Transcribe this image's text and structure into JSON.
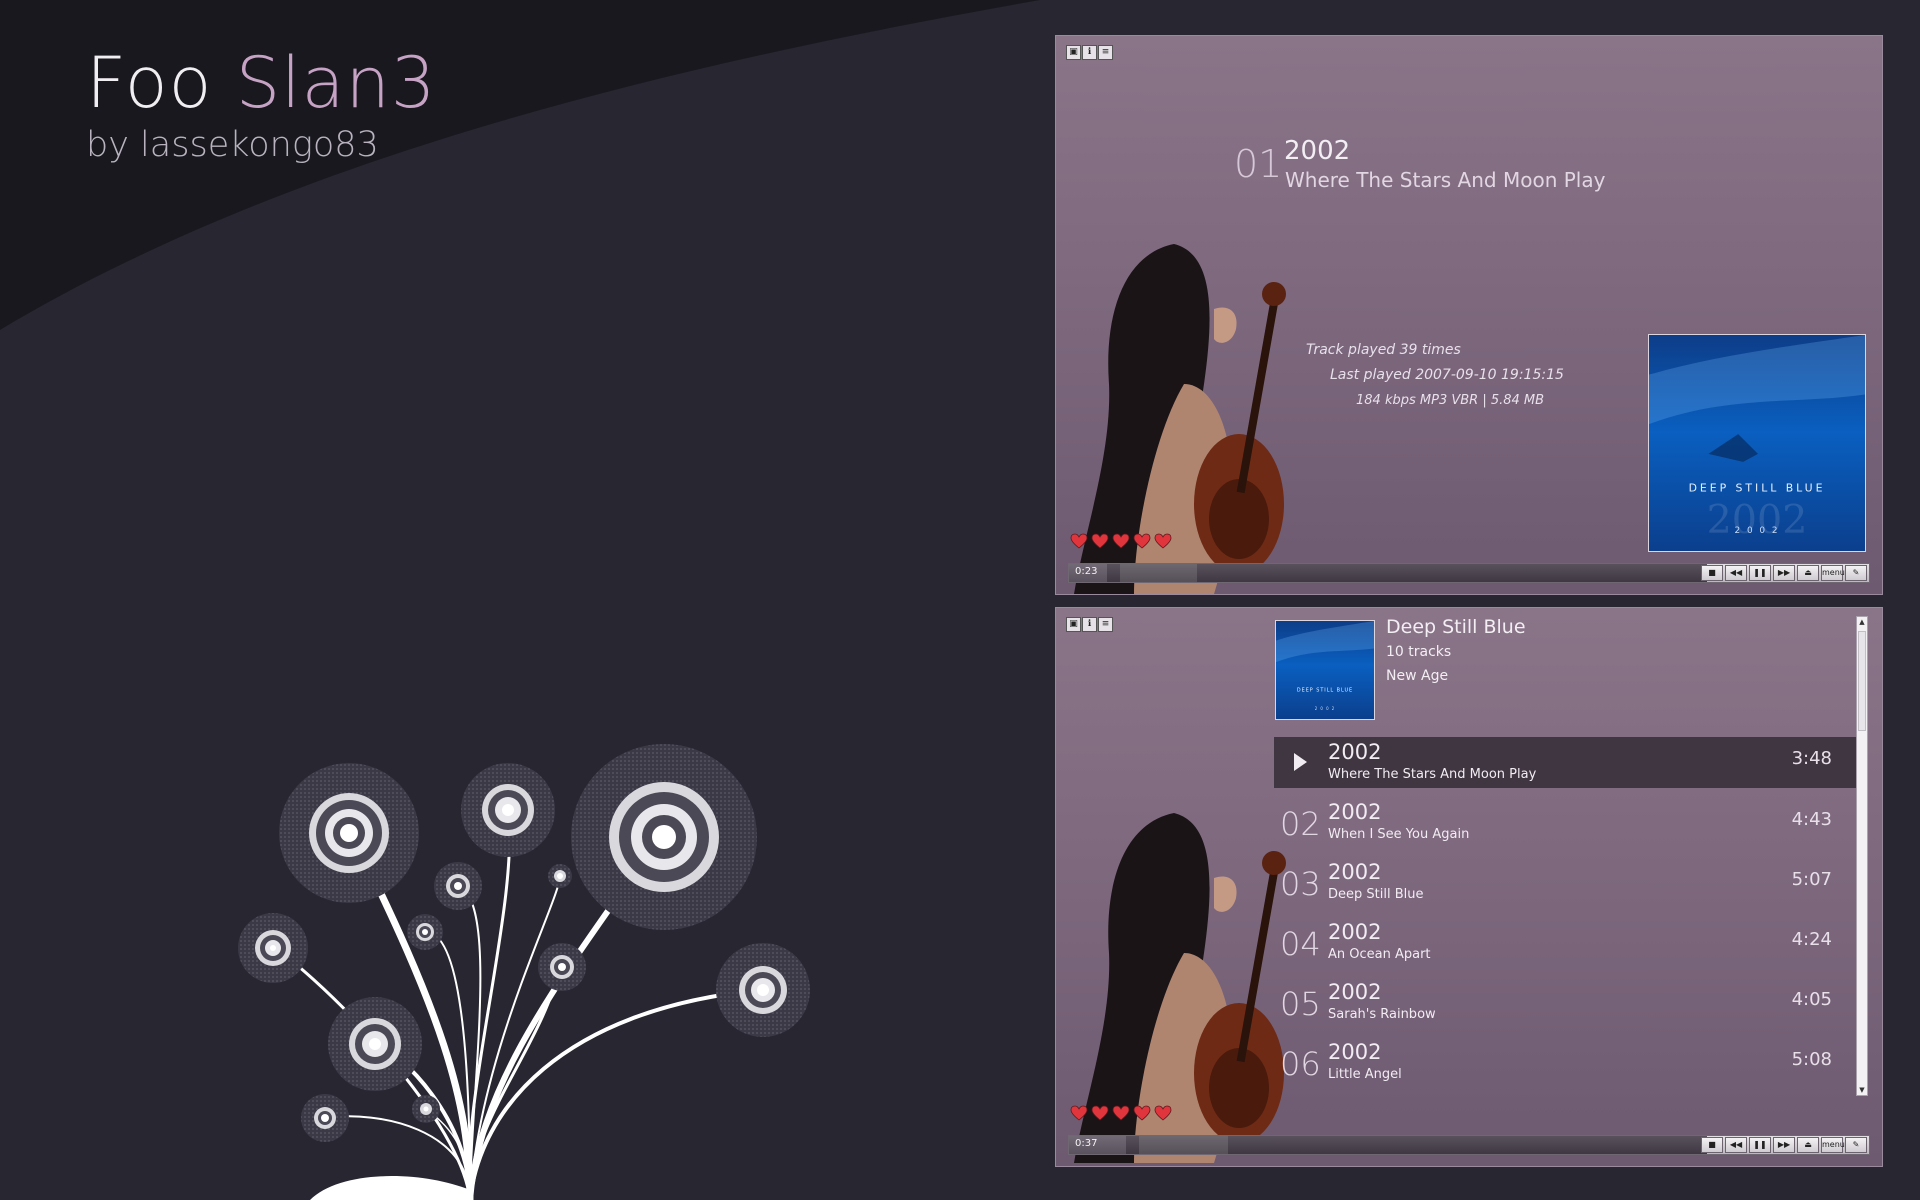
{
  "branding": {
    "title_main": "Foo",
    "title_accent": "Slan3",
    "subtitle": "by lassekongo83"
  },
  "window_buttons": [
    "▣",
    "ℹ",
    "≡"
  ],
  "now_playing": {
    "track_number": "01",
    "year": "2002",
    "title": "Where The Stars And Moon Play",
    "play_count": "Track played 39 times",
    "last_played": "Last played 2007-09-10 19:15:15",
    "file_info": "184 kbps MP3 VBR | 5.84 MB",
    "rating": 5,
    "elapsed": "0:23",
    "progress": 0.06
  },
  "album": {
    "name": "Deep Still Blue",
    "track_count": "10 tracks",
    "genre": "New Age",
    "cover_text": "DEEP     STILL     BLUE",
    "cover_year": "2 0 0 2",
    "cover_watermark": "2002"
  },
  "playlist": {
    "elapsed": "0:37",
    "progress": 0.09,
    "rating": 5,
    "tracks": [
      {
        "number": "01",
        "year": "2002",
        "title": "Where The Stars And Moon Play",
        "duration": "3:48",
        "playing": true
      },
      {
        "number": "02",
        "year": "2002",
        "title": "When I See You Again",
        "duration": "4:43"
      },
      {
        "number": "03",
        "year": "2002",
        "title": "Deep Still Blue",
        "duration": "5:07"
      },
      {
        "number": "04",
        "year": "2002",
        "title": "An Ocean Apart",
        "duration": "4:24"
      },
      {
        "number": "05",
        "year": "2002",
        "title": "Sarah's Rainbow",
        "duration": "4:05"
      },
      {
        "number": "06",
        "year": "2002",
        "title": "Little Angel",
        "duration": "5:08"
      }
    ]
  },
  "transport": {
    "stop": "■",
    "prev": "◀◀",
    "pause": "❚❚",
    "next": "▶▶",
    "eject": "⏏",
    "menu": "menu",
    "settings": "✎"
  },
  "scrollbar": {
    "up": "▲",
    "down": "▼"
  },
  "colors": {
    "accent": "#c6a3c4",
    "panel": "#7b667c",
    "background": "#272631",
    "heart": "#e0353d"
  }
}
